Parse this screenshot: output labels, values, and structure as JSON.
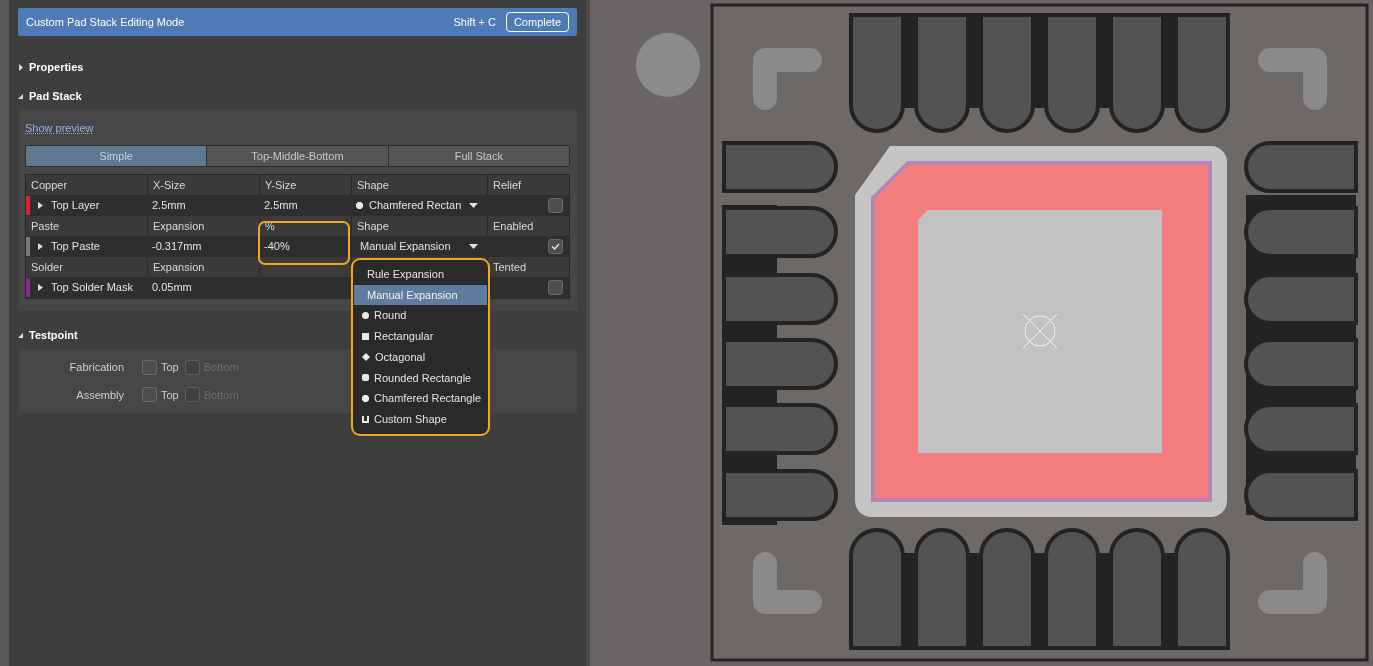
{
  "banner": {
    "title": "Custom Pad Stack Editing Mode",
    "shortcut": "Shift + C",
    "button": "Complete"
  },
  "sections": [
    {
      "label": "Properties",
      "expanded": false
    },
    {
      "label": "Pad Stack",
      "expanded": true
    },
    {
      "label": "Testpoint",
      "expanded": true
    }
  ],
  "show_preview": "Show preview",
  "mode_tabs": [
    {
      "label": "Simple",
      "selected": true
    },
    {
      "label": "Top-Middle-Bottom",
      "selected": false
    },
    {
      "label": "Full Stack",
      "selected": false
    }
  ],
  "layer_groups": [
    {
      "headers": {
        "col_1": "Copper",
        "col_2": "X-Size",
        "col_3": "Y-Size",
        "col_4": "Shape",
        "col_5": "Relief"
      },
      "row": {
        "name": "Top Layer",
        "color": "#e0202a",
        "col_2": "2.5mm",
        "col_3": "2.5mm",
        "shape": "Chamfered Rectan",
        "checked": false
      }
    },
    {
      "headers": {
        "col_1": "Paste",
        "col_2": "Expansion",
        "col_3": "%",
        "col_4": "Shape",
        "col_5": "Enabled"
      },
      "row": {
        "name": "Top Paste",
        "color": "#7a7a7a",
        "col_2": "-0.317mm",
        "col_3": "-40%",
        "shape": "Manual Expansion",
        "checked": true
      }
    },
    {
      "headers": {
        "col_1": "Solder",
        "col_2": "Expansion",
        "col_5": "Tented"
      },
      "row": {
        "name": "Top Solder Mask",
        "color": "#8a2a8a",
        "col_2": "0.05mm",
        "checked": false
      }
    }
  ],
  "shape_menu": [
    {
      "label": "Rule Expansion",
      "kind": "none",
      "selected": false
    },
    {
      "label": "Manual Expansion",
      "kind": "none",
      "selected": true
    },
    {
      "label": "Round",
      "kind": "round",
      "selected": false
    },
    {
      "label": "Rectangular",
      "kind": "rect",
      "selected": false
    },
    {
      "label": "Octagonal",
      "kind": "octagon",
      "selected": false
    },
    {
      "label": "Rounded Rectangle",
      "kind": "rounded",
      "selected": false
    },
    {
      "label": "Chamfered Rectangle",
      "kind": "chamfered",
      "selected": false
    },
    {
      "label": "Custom Shape",
      "kind": "custom",
      "selected": false
    }
  ],
  "testpoint": [
    {
      "label": "Fabrication",
      "options": [
        {
          "label": "Top",
          "checked": false,
          "disabled": false
        },
        {
          "label": "Bottom",
          "checked": false,
          "disabled": true
        }
      ]
    },
    {
      "label": "Assembly",
      "options": [
        {
          "label": "Top",
          "checked": false,
          "disabled": false
        },
        {
          "label": "Bottom",
          "checked": false,
          "disabled": true
        }
      ]
    }
  ]
}
